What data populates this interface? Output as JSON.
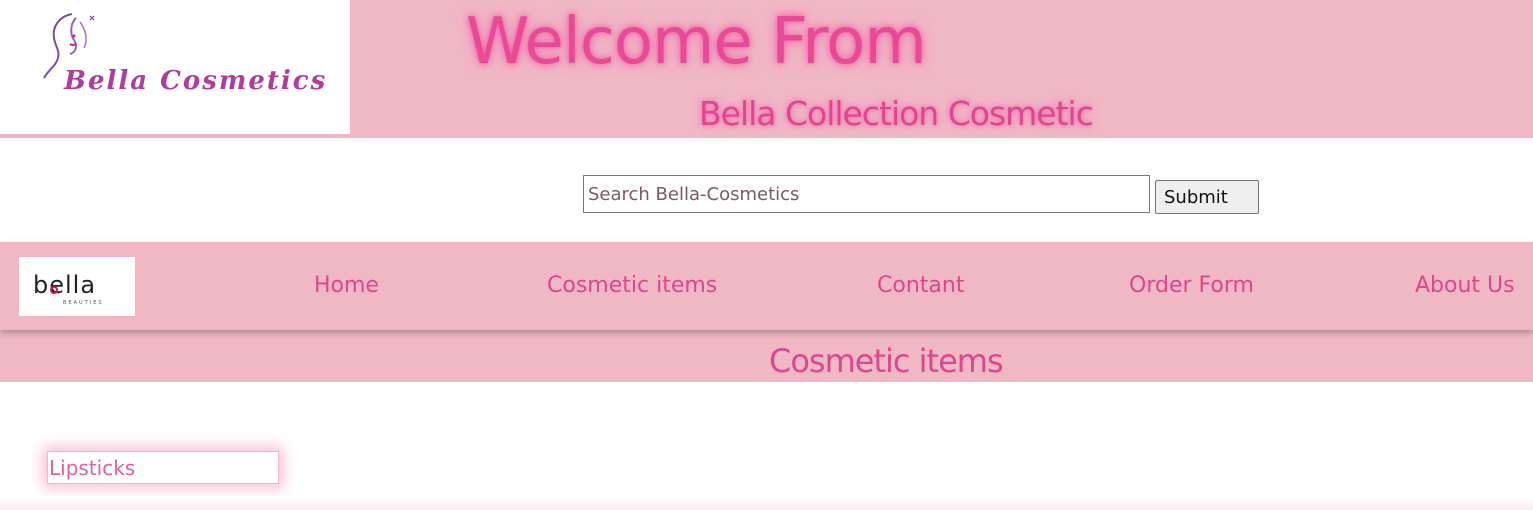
{
  "header": {
    "logo_text": "Bella Cosmetics",
    "welcome": "Welcome From",
    "subtitle": "Bella Collection Cosmetic"
  },
  "search": {
    "placeholder": "Search Bella-Cosmetics",
    "submit_label": "Submit"
  },
  "nav": {
    "logo_text": "bella",
    "logo_sub": "BEAUTIES",
    "items": [
      {
        "label": "Home"
      },
      {
        "label": "Cosmetic items"
      },
      {
        "label": "Contant"
      },
      {
        "label": "Order Form"
      },
      {
        "label": "About Us"
      }
    ]
  },
  "section": {
    "title": "Cosmetic items"
  },
  "categories": [
    {
      "label": "Lipsticks"
    }
  ],
  "colors": {
    "brand_pink": "#f0b7c5",
    "text_pink": "#e0468e",
    "logo_purple": "#b13c9b"
  }
}
